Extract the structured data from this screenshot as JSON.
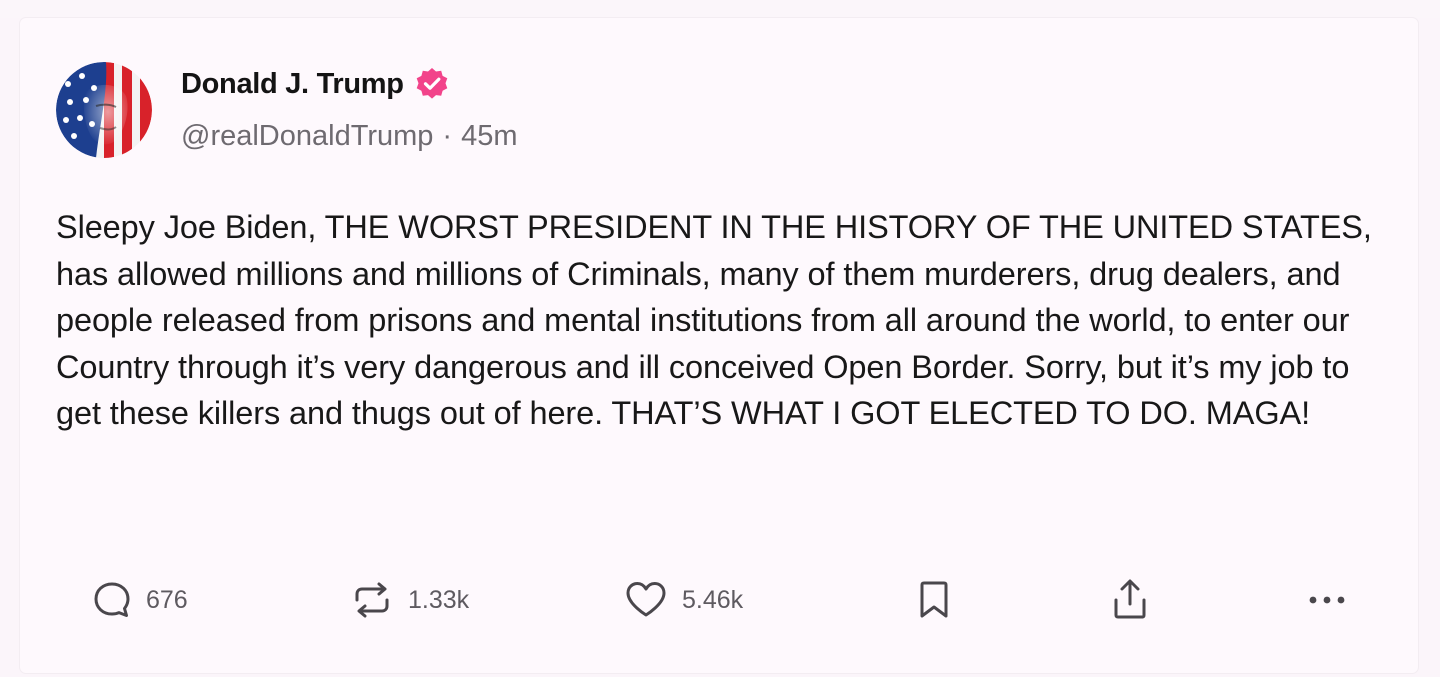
{
  "post": {
    "author_name": "Donald J. Trump",
    "handle": "@realDonaldTrump",
    "separator": "·",
    "time_ago": "45m",
    "verified": true,
    "verified_color": "#f2438a",
    "avatar_icon": "flag-portrait-avatar",
    "text": "Sleepy Joe Biden, THE WORST PRESIDENT IN THE HISTORY OF THE UNITED STATES, has allowed millions and millions of Criminals, many of them murderers, drug dealers, and people released from prisons and mental institutions from all around the world, to enter our Country through it’s very dangerous and ill conceived Open Border. Sorry, but it’s my job to get these killers and thugs out of here. THAT’S WHAT I GOT ELECTED TO DO. MAGA!"
  },
  "actions": {
    "reply": {
      "icon": "reply-icon",
      "count": "676"
    },
    "repost": {
      "icon": "repost-icon",
      "count": "1.33k"
    },
    "like": {
      "icon": "heart-icon",
      "count": "5.46k"
    },
    "bookmark": {
      "icon": "bookmark-icon"
    },
    "share": {
      "icon": "share-icon"
    },
    "more": {
      "icon": "more-icon"
    }
  }
}
